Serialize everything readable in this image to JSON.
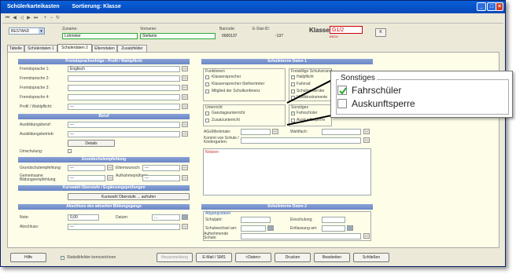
{
  "window": {
    "title": "Schülerkarteikasten",
    "sort": "Sortierung: Klasse"
  },
  "toolbar": {
    "nav_icons": [
      "first",
      "prev",
      "prev-page",
      "next",
      "next-page",
      "last",
      "plus",
      "minus",
      "refresh"
    ]
  },
  "header": {
    "state": "BESTAND",
    "zuname_label": "Zuname:",
    "zuname": "Lohmeier",
    "vorname_label": "Vorname:",
    "vorname": "Stefanie",
    "barcode_label": "Barcode:",
    "barcode": "0000137",
    "estatid_label": "E-Stat-ID:",
    "estatid": "-137",
    "klasse_label": "Klasse:",
    "klasse": "G1/2",
    "klasse_sub": "BSO2",
    "k_button": "K"
  },
  "tabs": [
    "Tabelle",
    "Schülerdaten 1",
    "Schülerdaten 2",
    "Elterndaten",
    "Zusatzfelder"
  ],
  "active_tab": 2,
  "fremd": {
    "title": "Fremdsprachenfolge - Profil / Wahlpflicht",
    "rows": [
      {
        "label": "Fremdsprache 1:",
        "value": "Englisch"
      },
      {
        "label": "Fremdsprache 2:",
        "value": ""
      },
      {
        "label": "Fremdsprache 3:",
        "value": ""
      },
      {
        "label": "Fremdsprache 4:",
        "value": ""
      },
      {
        "label": "Profil / Wahlpflicht:",
        "value": "---"
      }
    ]
  },
  "beruf": {
    "title": "Beruf",
    "rows": [
      {
        "label": "Ausbildungsberuf:",
        "value": "---"
      },
      {
        "label": "Ausbildungsbetrieb:",
        "value": "---"
      }
    ],
    "details": "Details",
    "umschulung": "Umschulung:"
  },
  "grund": {
    "title": "Grundschulempfehlung",
    "gs_label": "Grundschulempfehlung:",
    "gs_value": "---",
    "eltern_label": "Elternwunsch:",
    "eltern_value": "---",
    "gem_label": "Gemeinsame Bildungsempfehlung:",
    "gem_value": "---",
    "auf_label": "Aufnahmeprüfung:",
    "auf_value": "---"
  },
  "kurswahl": {
    "title": "Kurswahl Oberstufe / Ergänzungsprüfungen",
    "button": "Kurswahl Oberstufe ... aufrufen"
  },
  "abschluss": {
    "title": "Abschluss des aktuellen Bildungsgangs",
    "note_label": "Note:",
    "note": "0,00",
    "datum_label": "Datum:",
    "datum": "...",
    "abschluss_label": "Abschluss:",
    "abschluss": "---"
  },
  "intern1": {
    "title": "Schulinterne Daten 1",
    "funktionen_title": "Funktionen",
    "funktionen": [
      "Klassensprecher",
      "Klassensprecher-Stellvertreter",
      "Mitglied der Schulkonferenz"
    ],
    "freiwillig_title": "Freiwillige Schulveranst.",
    "freiwillig": [
      {
        "label": "Hallpflicht",
        "checked": true
      },
      {
        "label": "Fahrrad",
        "checked": false
      },
      {
        "label": "Schulgarderobe",
        "checked": false
      },
      {
        "label": "Musikinstrumente",
        "checked": false
      }
    ],
    "unterricht_title": "Unterricht",
    "unterricht": [
      "Ganztagsunterricht",
      "Zusatzunterricht"
    ],
    "sonstiges_title": "Sonstiges",
    "sonstiges": [
      {
        "label": "Fahrschüler",
        "checked": true
      },
      {
        "label": "Auskunftssperre",
        "checked": false
      }
    ],
    "ag_label": "AGs/Merkmale:",
    "wahlfach_label": "Wahlfach:",
    "komm_label": "Kommt von Schule / Kindergarten:",
    "notizen": "Notizen"
  },
  "intern2": {
    "title": "Schulinterne Daten 2",
    "abgang_title": "Abgangsdaten",
    "schuljahr_label": "Schuljahr:",
    "einschulung_label": "Einschulung:",
    "wechsel_label": "Schulwechsel am:",
    "entlassung_label": "Entlassung am:",
    "aufnehmende_label": "Aufnehmende Schule:"
  },
  "footer": {
    "hilfe": "Hilfe",
    "statistik": "Statistikfelder kennzeichnen",
    "neuanmeldung": "Neuanmeldung",
    "email": "E-Mail / SMS",
    "daten": "<Daten>",
    "drucken": "Drucken",
    "bearbeiten": "Bearbeiten",
    "schliessen": "Schließen"
  },
  "callout": {
    "title": "Sonstiges",
    "items": [
      {
        "label": "Fahrschüler",
        "checked": true
      },
      {
        "label": "Auskunftsperre",
        "checked": false
      }
    ]
  },
  "colors": {
    "title_bar": "#0a5fd8",
    "section_header": "#7a94ce",
    "panel_bg": "#fdfde8",
    "klasse_red": "#cc0000",
    "name_border": "#2fa83a"
  }
}
